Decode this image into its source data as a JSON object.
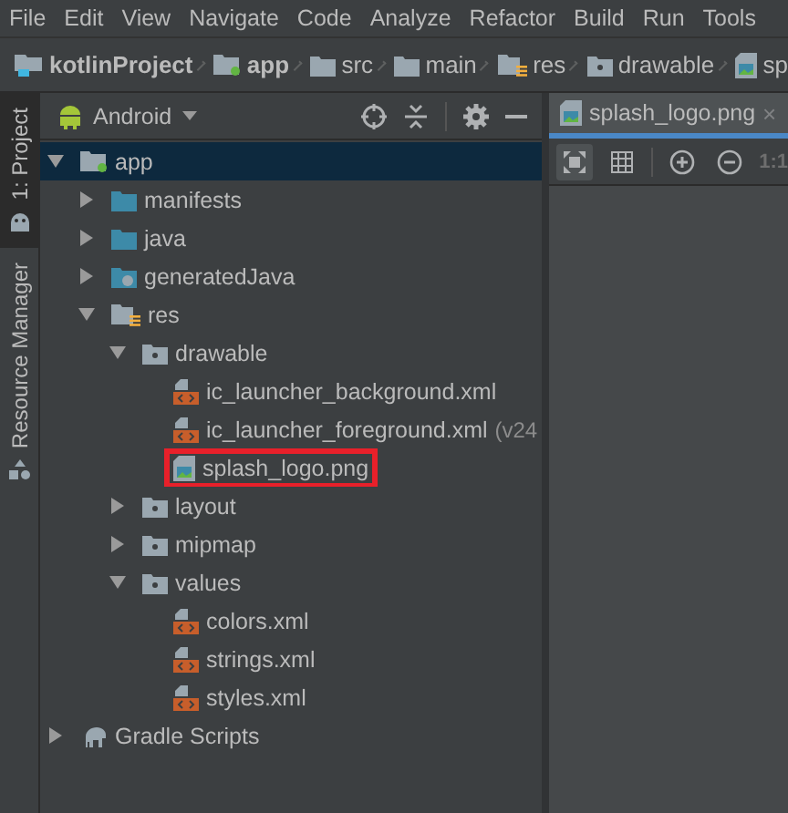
{
  "menu": [
    "File",
    "Edit",
    "View",
    "Navigate",
    "Code",
    "Analyze",
    "Refactor",
    "Build",
    "Run",
    "Tools"
  ],
  "breadcrumbs": [
    {
      "label": "kotlinProject",
      "kind": "project"
    },
    {
      "label": "app",
      "kind": "module"
    },
    {
      "label": "src",
      "kind": "folder"
    },
    {
      "label": "main",
      "kind": "folder"
    },
    {
      "label": "res",
      "kind": "res"
    },
    {
      "label": "drawable",
      "kind": "resfolder"
    },
    {
      "label": "sp",
      "kind": "image"
    }
  ],
  "side_tabs": [
    {
      "label": "1: Project",
      "selected": true
    },
    {
      "label": "Resource Manager",
      "selected": false
    }
  ],
  "project_panel": {
    "view": "Android",
    "tree": [
      {
        "label": "app",
        "kind": "module",
        "expanded": true,
        "selected": true,
        "children": [
          {
            "label": "manifests",
            "kind": "bluefolder",
            "expanded": false,
            "selected": false
          },
          {
            "label": "java",
            "kind": "bluefolder",
            "expanded": false,
            "selected": false
          },
          {
            "label": "generatedJava",
            "kind": "genfolder",
            "expanded": false,
            "selected": false
          },
          {
            "label": "res",
            "kind": "res",
            "expanded": true,
            "selected": false,
            "children": [
              {
                "label": "drawable",
                "kind": "resfolder",
                "expanded": true,
                "selected": false,
                "children": [
                  {
                    "label": "ic_launcher_background.xml",
                    "kind": "xml",
                    "selected": false
                  },
                  {
                    "label": "ic_launcher_foreground.xml",
                    "note": "(v24",
                    "kind": "xml",
                    "selected": false
                  },
                  {
                    "label": "splash_logo.png",
                    "kind": "image",
                    "selected": false,
                    "marked": true
                  }
                ]
              },
              {
                "label": "layout",
                "kind": "resfolder",
                "expanded": false,
                "selected": false
              },
              {
                "label": "mipmap",
                "kind": "resfolder",
                "expanded": false,
                "selected": false
              },
              {
                "label": "values",
                "kind": "resfolder",
                "expanded": true,
                "selected": false,
                "children": [
                  {
                    "label": "colors.xml",
                    "kind": "xml",
                    "selected": false
                  },
                  {
                    "label": "strings.xml",
                    "kind": "xml",
                    "selected": false
                  },
                  {
                    "label": "styles.xml",
                    "kind": "xml",
                    "selected": false
                  }
                ]
              }
            ]
          }
        ]
      },
      {
        "label": "Gradle Scripts",
        "kind": "gradle",
        "expanded": false,
        "selected": false
      }
    ]
  },
  "editor": {
    "tab": {
      "label": "splash_logo.png",
      "close": "×"
    },
    "zoom_label": "1:1"
  }
}
